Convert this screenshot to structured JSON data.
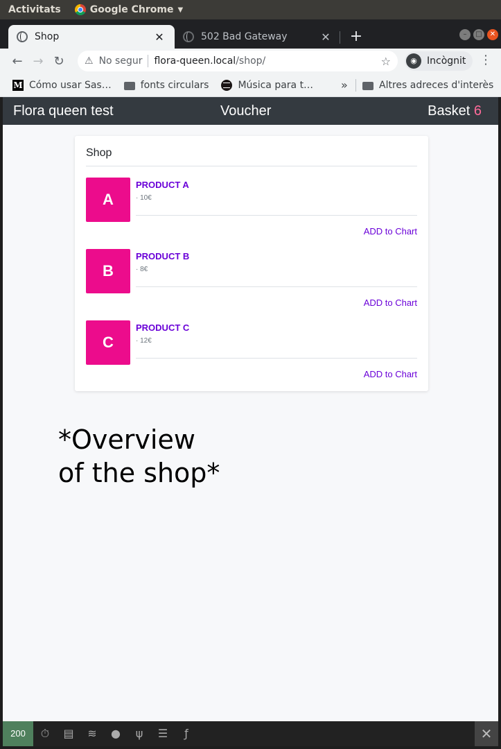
{
  "os": {
    "activities": "Activitats",
    "app_name": "Google Chrome"
  },
  "tabs": [
    {
      "title": "Shop",
      "active": true,
      "close": "✕"
    },
    {
      "title": "502 Bad Gateway",
      "active": false,
      "close": "✕"
    }
  ],
  "browser": {
    "new_tab": "+",
    "not_secure": "No segur",
    "url_host": "flora-queen.local",
    "url_path": "/shop/",
    "incognito_label": "Incògnit",
    "menu": "⋮"
  },
  "bookmarks": {
    "items": [
      {
        "label": "Cómo usar Sas…",
        "icon": "medium-icon"
      },
      {
        "label": "fonts circulars",
        "icon": "folder-icon"
      },
      {
        "label": "Música para t…",
        "icon": "spotify-icon"
      }
    ],
    "more": "»",
    "other": "Altres adreces d'interès"
  },
  "site": {
    "brand": "Flora queen test",
    "voucher": "Voucher",
    "basket_label": "Basket",
    "basket_count": "6",
    "basket_count_color": "#ff6b9a"
  },
  "shop": {
    "title": "Shop",
    "products": [
      {
        "letter": "A",
        "name": "PRODUCT A",
        "price": "· 10€",
        "action": "ADD to Chart"
      },
      {
        "letter": "B",
        "name": "PRODUCT B",
        "price": "· 8€",
        "action": "ADD to Chart"
      },
      {
        "letter": "C",
        "name": "PRODUCT C",
        "price": "· 12€",
        "action": "ADD to Chart"
      }
    ],
    "thumb_color": "#ec0c8c",
    "accent_color": "#6a00d8"
  },
  "overview_note": "*Overview\nof the shop*",
  "debug_toolbar": {
    "status": "200",
    "status_color": "#4f805d",
    "close": "✕"
  }
}
